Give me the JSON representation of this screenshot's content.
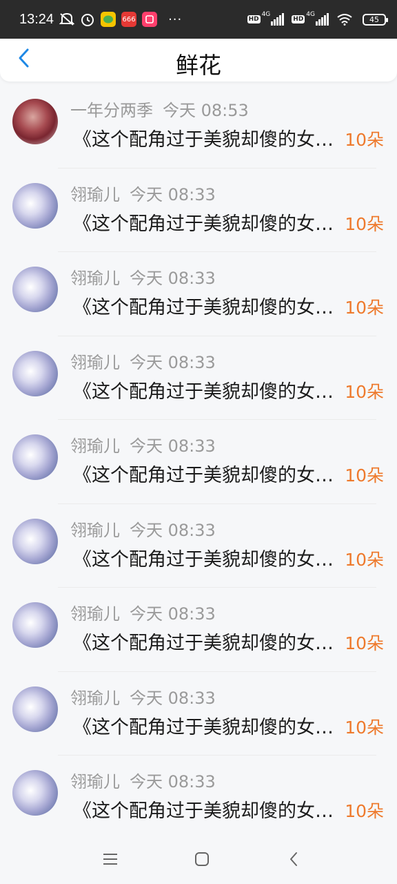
{
  "status_bar": {
    "time": "13:24",
    "app_badge": "666",
    "more": "···",
    "hd1": "HD",
    "net1": "4G",
    "hd2": "HD",
    "net2": "4G",
    "battery": "45"
  },
  "header": {
    "title": "鲜花"
  },
  "items": [
    {
      "user": "一年分两季",
      "time": "今天 08:53",
      "message": "《这个配角过于美貌却傻的女人》",
      "count": "10朵"
    },
    {
      "user": "翎瑜儿",
      "time": "今天 08:33",
      "message": "《这个配角过于美貌却傻的女人》",
      "count": "10朵"
    },
    {
      "user": "翎瑜儿",
      "time": "今天 08:33",
      "message": "《这个配角过于美貌却傻的女人》",
      "count": "10朵"
    },
    {
      "user": "翎瑜儿",
      "time": "今天 08:33",
      "message": "《这个配角过于美貌却傻的女人》",
      "count": "10朵"
    },
    {
      "user": "翎瑜儿",
      "time": "今天 08:33",
      "message": "《这个配角过于美貌却傻的女人》",
      "count": "10朵"
    },
    {
      "user": "翎瑜儿",
      "time": "今天 08:33",
      "message": "《这个配角过于美貌却傻的女人》",
      "count": "10朵"
    },
    {
      "user": "翎瑜儿",
      "time": "今天 08:33",
      "message": "《这个配角过于美貌却傻的女人》",
      "count": "10朵"
    },
    {
      "user": "翎瑜儿",
      "time": "今天 08:33",
      "message": "《这个配角过于美貌却傻的女人》",
      "count": "10朵"
    },
    {
      "user": "翎瑜儿",
      "time": "今天 08:33",
      "message": "《这个配角过于美貌却傻的女人》",
      "count": "10朵"
    }
  ],
  "colors": {
    "accent": "#1e88e5",
    "count": "#ee7a2d",
    "meta": "#9a9a9a"
  },
  "icons": {
    "back": "chevron-left-icon",
    "nav_menu": "menu-icon",
    "nav_home": "home-icon",
    "nav_back": "back-icon"
  }
}
